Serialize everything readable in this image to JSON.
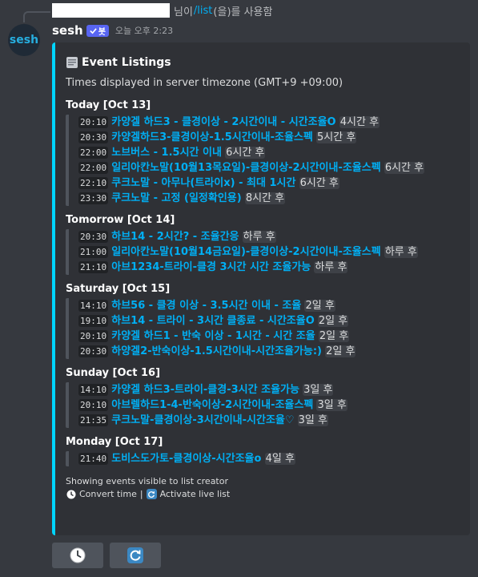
{
  "reply": {
    "suffix_before": "님이",
    "command": "/list",
    "suffix_after": "(을)를 사용함"
  },
  "avatar": {
    "text": "sesh"
  },
  "message": {
    "username": "sesh",
    "badge": "봇",
    "timestamp": "오늘 오후 2:23"
  },
  "embed": {
    "accent_color": "#00d5ff",
    "icon": "document-icon",
    "title": "Event Listings",
    "timezone_note": "Times displayed in server timezone (GMT+9 +09:00)",
    "days": [
      {
        "label": "Today [Oct 13]",
        "events": [
          {
            "time": "20:10",
            "title": "카양겔 하드3 - 클경이상 - 2시간이내 - 시간조율O",
            "rel": "4시간 후"
          },
          {
            "time": "20:30",
            "title": "카양겔하드3-클경이상-1.5시간이내-조율스펙",
            "rel": "5시간 후"
          },
          {
            "time": "22:00",
            "title": "노브버스 - 1.5시간 이내",
            "rel": "6시간 후"
          },
          {
            "time": "22:00",
            "title": "일리아칸노말(10월13목요일)-클경이상-2시간이내-조율스펙",
            "rel": "6시간 후"
          },
          {
            "time": "22:10",
            "title": "쿠크노말 - 아무나(트라이x) - 최대 1시간",
            "rel": "6시간 후"
          },
          {
            "time": "23:30",
            "title": "쿠크노말 - 고정 (일정확인용)",
            "rel": "8시간 후"
          }
        ]
      },
      {
        "label": "Tomorrow [Oct 14]",
        "events": [
          {
            "time": "20:30",
            "title": "하브14 - 2시간? - 조율간응",
            "rel": "하루 후"
          },
          {
            "time": "21:00",
            "title": "일리아칸노말(10월14금요일)-클경이상-2시간이내-조율스펙",
            "rel": "하루 후"
          },
          {
            "time": "21:10",
            "title": "아브1234-트라이-클경 3시간 시간 조율가능",
            "rel": "하루 후"
          }
        ]
      },
      {
        "label": "Saturday [Oct 15]",
        "events": [
          {
            "time": "14:10",
            "title": "하브56 - 클경 이상 - 3.5시간 이내 - 조율",
            "rel": "2일 후"
          },
          {
            "time": "19:10",
            "title": "하브14 - 트라이 - 3시간 클종료 - 시간조율O",
            "rel": "2일 후"
          },
          {
            "time": "20:10",
            "title": "카양겔 하드1 - 반숙 이상 - 1시간 - 시간 조율",
            "rel": "2일 후"
          },
          {
            "time": "20:30",
            "title": "하양겔2-반숙이상-1.5시간이내-시간조율가능:)",
            "rel": "2일 후"
          }
        ]
      },
      {
        "label": "Sunday [Oct 16]",
        "events": [
          {
            "time": "14:10",
            "title": "카양겔 하드3-트라이-클경-3시간 조율가능",
            "rel": "3일 후"
          },
          {
            "time": "20:10",
            "title": "아브렐하드1-4-반숙이상-2시간이내-조율스펙",
            "rel": "3일 후"
          },
          {
            "time": "21:35",
            "title": "쿠크노말-클경이상-3시간이내-시간조율♡",
            "rel": "3일 후"
          }
        ]
      },
      {
        "label": "Monday [Oct 17]",
        "events": [
          {
            "time": "21:40",
            "title": "도비스도가토-클경이상-시간조율o",
            "rel": "4일 후"
          }
        ]
      }
    ],
    "footer": {
      "note": "Showing events visible to list creator",
      "convert_label": "Convert time",
      "separator": "|",
      "activate_label": "Activate live list"
    }
  },
  "buttons": [
    {
      "icon": "clock-icon"
    },
    {
      "icon": "refresh-icon"
    }
  ]
}
